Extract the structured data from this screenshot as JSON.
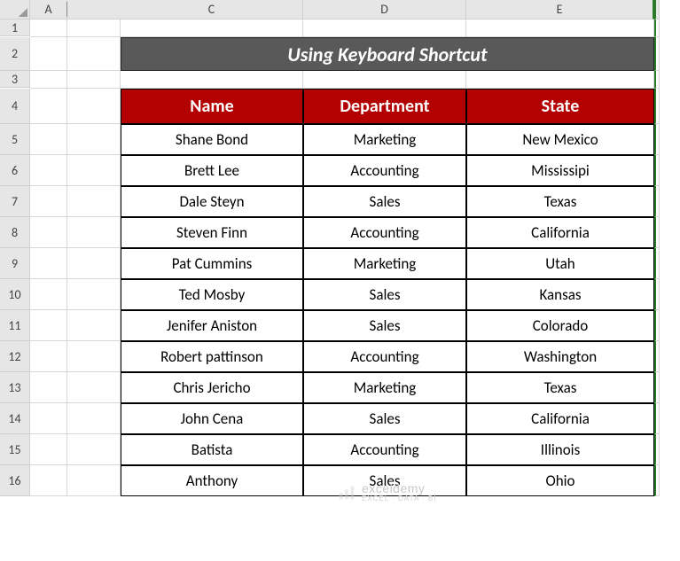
{
  "column_headers": [
    "A",
    "C",
    "D",
    "E"
  ],
  "row_numbers": [
    1,
    2,
    3,
    4,
    5,
    6,
    7,
    8,
    9,
    10,
    11,
    12,
    13,
    14,
    15,
    16
  ],
  "title": "Using Keyboard Shortcut",
  "table": {
    "headers": [
      "Name",
      "Department",
      "State"
    ],
    "rows": [
      [
        "Shane Bond",
        "Marketing",
        "New Mexico"
      ],
      [
        "Brett Lee",
        "Accounting",
        "Mississipi"
      ],
      [
        "Dale Steyn",
        "Sales",
        "Texas"
      ],
      [
        "Steven Finn",
        "Accounting",
        "California"
      ],
      [
        "Pat Cummins",
        "Marketing",
        "Utah"
      ],
      [
        "Ted Mosby",
        "Sales",
        "Kansas"
      ],
      [
        "Jenifer Aniston",
        "Sales",
        "Colorado"
      ],
      [
        "Robert pattinson",
        "Accounting",
        "Washington"
      ],
      [
        "Chris Jericho",
        "Marketing",
        "Texas"
      ],
      [
        "John Cena",
        "Sales",
        "California"
      ],
      [
        "Batista",
        "Accounting",
        "Illinois"
      ],
      [
        "Anthony",
        "Sales",
        "Ohio"
      ]
    ]
  },
  "watermark": {
    "brand": "exceldemy",
    "tagline": "EXCEL · DATA · BI"
  },
  "chart_data": {
    "type": "table",
    "title": "Using Keyboard Shortcut",
    "columns": [
      "Name",
      "Department",
      "State"
    ],
    "rows": [
      [
        "Shane Bond",
        "Marketing",
        "New Mexico"
      ],
      [
        "Brett Lee",
        "Accounting",
        "Mississipi"
      ],
      [
        "Dale Steyn",
        "Sales",
        "Texas"
      ],
      [
        "Steven Finn",
        "Accounting",
        "California"
      ],
      [
        "Pat Cummins",
        "Marketing",
        "Utah"
      ],
      [
        "Ted Mosby",
        "Sales",
        "Kansas"
      ],
      [
        "Jenifer Aniston",
        "Sales",
        "Colorado"
      ],
      [
        "Robert pattinson",
        "Accounting",
        "Washington"
      ],
      [
        "Chris Jericho",
        "Marketing",
        "Texas"
      ],
      [
        "John Cena",
        "Sales",
        "California"
      ],
      [
        "Batista",
        "Accounting",
        "Illinois"
      ],
      [
        "Anthony",
        "Sales",
        "Ohio"
      ]
    ]
  }
}
